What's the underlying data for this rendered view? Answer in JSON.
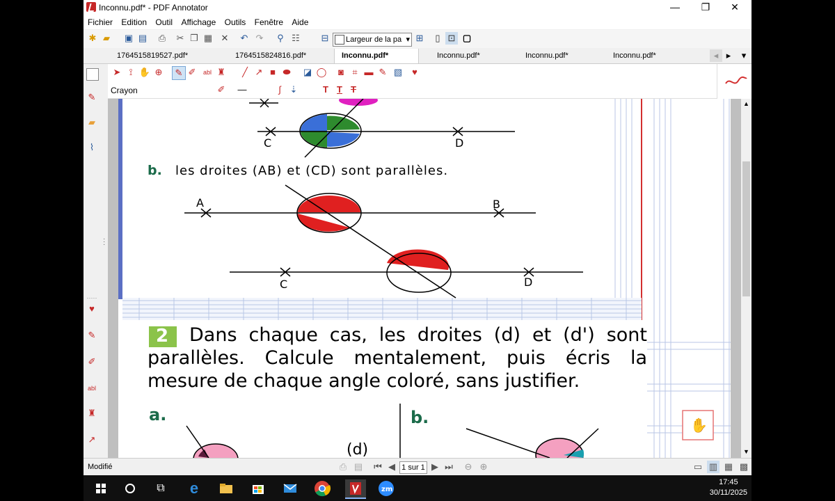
{
  "window": {
    "title": "Inconnu.pdf* - PDF Annotator",
    "controls": {
      "minimize": "—",
      "maximize": "❐",
      "close": "✕"
    }
  },
  "menu": [
    "Fichier",
    "Edition",
    "Outil",
    "Affichage",
    "Outils",
    "Fenêtre",
    "Aide"
  ],
  "toolbar": {
    "zoom_value": "Largeur de la pa"
  },
  "tabs": [
    "1764515819527.pdf*",
    "1764515824816.pdf*",
    "Inconnu.pdf*",
    "Inconnu.pdf*",
    "Inconnu.pdf*",
    "Inconnu.pdf*"
  ],
  "active_tab_index": 2,
  "pen_toolbar": {
    "tool_name": "Crayon"
  },
  "document": {
    "fig_top": {
      "label_c": "C",
      "label_d": "D"
    },
    "item_b_letter": "b.",
    "item_b_text": "les droites (AB) et (CD) sont parallèles.",
    "fig_b": {
      "label_a": "A",
      "label_b": "B",
      "label_c": "C",
      "label_d": "D"
    },
    "exercise_number": "2",
    "exercise_text": "Dans chaque cas, les droites (d) et (d') sont parallèles. Calcule mentalement, puis écris la mesure de chaque angle coloré, sans justifier.",
    "sub_a": "a.",
    "sub_b": "b.",
    "label_d": "(d)"
  },
  "status": {
    "text": "Modifié",
    "page_indicator": "1 sur 1"
  },
  "taskbar": {
    "time": "17:45",
    "date": "30/11/2025"
  },
  "colors": {
    "accent_red": "#c62828",
    "exercise_green": "#8bc34a",
    "heading_green": "#1b6b4a"
  }
}
